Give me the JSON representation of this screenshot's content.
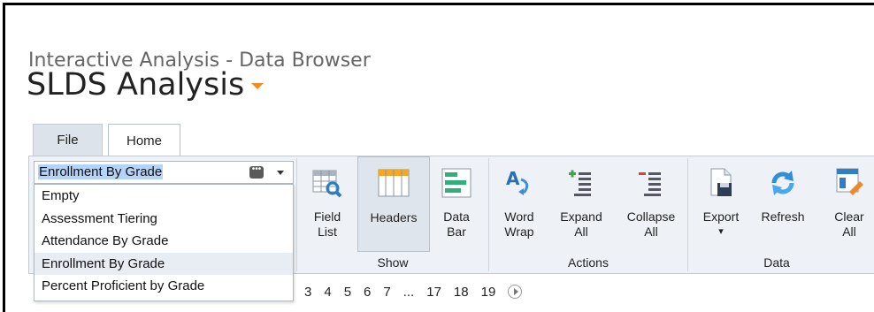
{
  "header": {
    "subtitle": "Interactive Analysis - Data Browser",
    "title": "SLDS Analysis"
  },
  "tabs": [
    {
      "label": "File"
    },
    {
      "label": "Home"
    }
  ],
  "report_selector": {
    "value": "Enrollment By Grade",
    "options": [
      "Empty",
      "Assessment Tiering",
      "Attendance By Grade",
      "Enrollment By Grade",
      "Percent Proficient by Grade"
    ],
    "selected_option": "Enrollment By Grade"
  },
  "ribbon": {
    "show": {
      "label": "Show",
      "buttons": [
        {
          "line1": "Field",
          "line2": "List",
          "icon": "field-list-icon"
        },
        {
          "line1": "Headers",
          "line2": "",
          "icon": "headers-icon",
          "active": true
        },
        {
          "line1": "Data",
          "line2": "Bar",
          "icon": "data-bar-icon"
        }
      ]
    },
    "actions": {
      "label": "Actions",
      "buttons": [
        {
          "line1": "Word",
          "line2": "Wrap",
          "icon": "word-wrap-icon"
        },
        {
          "line1": "Expand",
          "line2": "All",
          "icon": "expand-all-icon"
        },
        {
          "line1": "Collapse",
          "line2": "All",
          "icon": "collapse-all-icon"
        }
      ]
    },
    "data": {
      "label": "Data",
      "buttons": [
        {
          "line1": "Export",
          "line2": "▾",
          "icon": "export-icon"
        },
        {
          "line1": "Refresh",
          "line2": "",
          "icon": "refresh-icon"
        },
        {
          "line1": "Clear",
          "line2": "All",
          "icon": "clear-all-icon"
        }
      ]
    }
  },
  "pager": {
    "pages": [
      "3",
      "4",
      "5",
      "6",
      "7",
      "...",
      "17",
      "18",
      "19"
    ]
  },
  "colors": {
    "accent": "#f28c1e",
    "ribbon_bg": "#eef2f6",
    "selection": "#b5d3f7"
  }
}
